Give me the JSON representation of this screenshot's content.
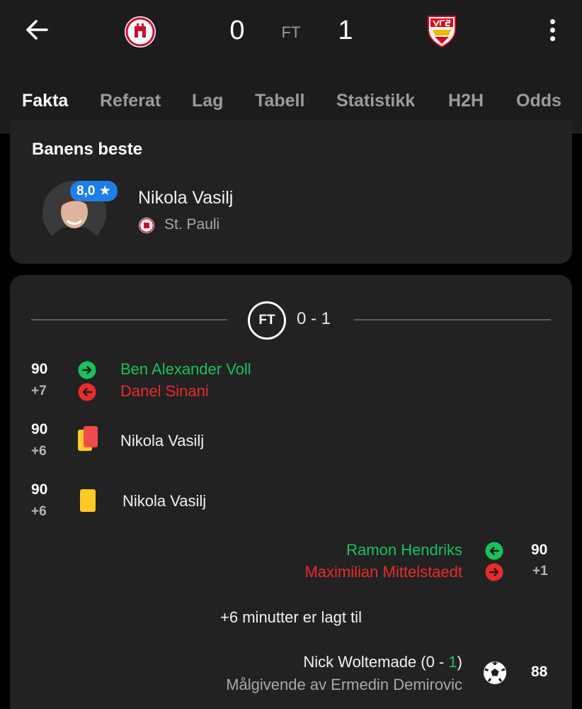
{
  "match": {
    "home_score": "0",
    "away_score": "1",
    "status": "FT"
  },
  "tabs": [
    "Fakta",
    "Referat",
    "Lag",
    "Tabell",
    "Statistikk",
    "H2H",
    "Odds"
  ],
  "best_player": {
    "title": "Banens beste",
    "rating": "8,0",
    "name": "Nikola Vasilj",
    "team": "St. Pauli"
  },
  "timeline": {
    "period_label": "FT",
    "period_score": "0 - 1",
    "events": [
      {
        "minute": "90",
        "added": "+7",
        "in": "Ben Alexander Voll",
        "out": "Danel Sinani"
      },
      {
        "minute": "90",
        "added": "+6",
        "player": "Nikola Vasilj"
      },
      {
        "minute": "90",
        "added": "+6",
        "player": "Nikola Vasilj"
      },
      {
        "minute": "90",
        "added": "+1",
        "in": "Ramon Hendriks",
        "out": "Maximilian Mittelstaedt"
      },
      {
        "info": "+6 minutter er lagt til"
      },
      {
        "minute": "88",
        "scorer": "Nick Woltemade",
        "score_prefix": "(0 - ",
        "score_highlight": "1",
        "score_suffix": ")",
        "assist": "Målgivende av Ermedin Demirovic"
      }
    ]
  },
  "colors": {
    "accent": "#00c853",
    "sub_in": "#19c25a",
    "sub_out": "#ea2b2b",
    "rating_badge": "#1e7ee8",
    "yellow_card": "#ffc928",
    "red_card": "#f04c4c"
  },
  "icons": {
    "back": "arrow-left-icon",
    "more": "more-vertical-icon",
    "sub_in": "arrow-right-circle-icon",
    "sub_out": "arrow-left-circle-icon",
    "second_yellow": "second-yellow-card-icon",
    "yellow": "yellow-card-icon",
    "goal": "football-icon"
  }
}
